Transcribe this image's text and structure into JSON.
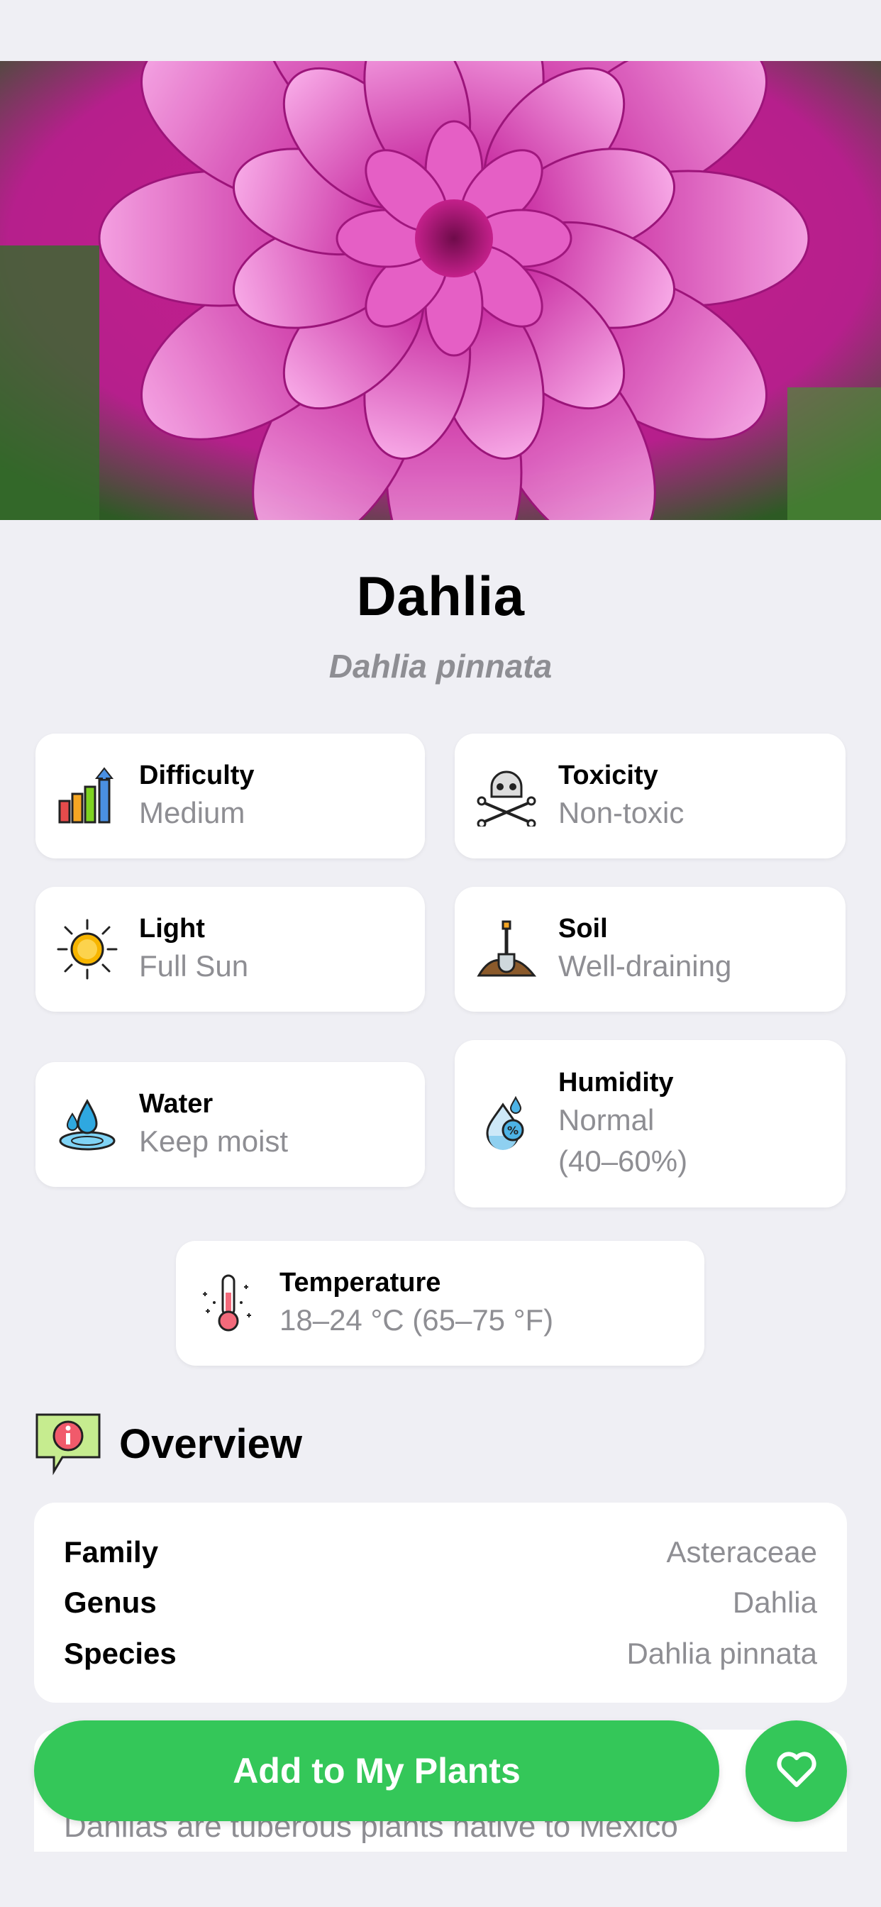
{
  "plant": {
    "name": "Dahlia",
    "scientific_name": "Dahlia pinnata"
  },
  "care": {
    "difficulty": {
      "label": "Difficulty",
      "value": "Medium",
      "icon": "difficulty-bars-icon"
    },
    "toxicity": {
      "label": "Toxicity",
      "value": "Non-toxic",
      "icon": "skull-crossbones-icon"
    },
    "light": {
      "label": "Light",
      "value": "Full Sun",
      "icon": "sun-icon"
    },
    "soil": {
      "label": "Soil",
      "value": "Well-draining",
      "icon": "shovel-soil-icon"
    },
    "water": {
      "label": "Water",
      "value": "Keep moist",
      "icon": "water-drops-icon"
    },
    "humidity": {
      "label": "Humidity",
      "value": "Normal",
      "value2": "(40–60%)",
      "icon": "humidity-percent-icon"
    },
    "temperature": {
      "label": "Temperature",
      "value": "18–24 °C (65–75 °F)",
      "icon": "thermometer-icon"
    }
  },
  "overview": {
    "heading": "Overview",
    "icon": "info-speech-icon",
    "rows": [
      {
        "key": "Family",
        "value": "Asteraceae"
      },
      {
        "key": "Genus",
        "value": "Dahlia"
      },
      {
        "key": "Species",
        "value": "Dahlia pinnata"
      }
    ]
  },
  "description": {
    "text": "Dahlias are tuberous plants native to Mexico"
  },
  "actions": {
    "add_label": "Add to My Plants",
    "favorite_icon": "heart-icon"
  },
  "colors": {
    "accent": "#34c759",
    "background": "#efeff4",
    "secondary_text": "#8e8e93"
  }
}
